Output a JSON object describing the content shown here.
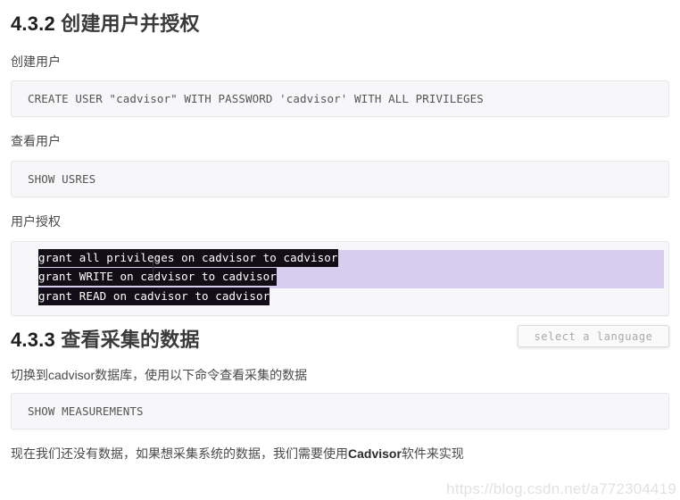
{
  "document": {
    "sections": [
      {
        "id": "4.3.2",
        "number": "4.3.2",
        "title": "创建用户并授权",
        "heading_full": "4.3.2 创建用户并授权"
      },
      {
        "id": "4.3.3",
        "number": "4.3.3",
        "title": "查看采集的数据",
        "heading_full": "4.3.3 查看采集的数据"
      }
    ],
    "labels": {
      "create_user": "创建用户",
      "view_user": "查看用户",
      "grant_user": "用户授权",
      "switch_db_note": "切换到cadvisor数据库，使用以下命令查看采集的数据"
    },
    "code_blocks": {
      "create_user_sql": "CREATE USER \"cadvisor\" WITH PASSWORD 'cadvisor' WITH ALL PRIVILEGES",
      "show_users_sql": "SHOW USRES",
      "grant_lines": [
        "grant all privileges on cadvisor to cadvisor",
        "grant WRITE on cadvisor to cadvisor",
        "grant READ on cadvisor to cadvisor"
      ],
      "show_measurements_sql": "SHOW MEASUREMENTS"
    },
    "closing_paragraph": {
      "prefix": "现在我们还没有数据，如果想采集系统的数据，我们需要使用",
      "bold": "Cadvisor",
      "suffix": "软件来实现"
    }
  },
  "overlay": {
    "language_selector_label": "select a language",
    "watermark": "https://blog.csdn.net/a772304419"
  },
  "colors": {
    "code_bg": "#f7f7f9",
    "code_border": "#e7e7ea",
    "selection_band": "#d6cdef",
    "selection_text_bg": "#120d17",
    "selection_text_fg": "#ffffff",
    "heading_text": "#2f2f2f",
    "body_text": "#4a4a4a",
    "tooltip_text": "#a9a9a9",
    "watermark_text": "#e2e2e2"
  }
}
